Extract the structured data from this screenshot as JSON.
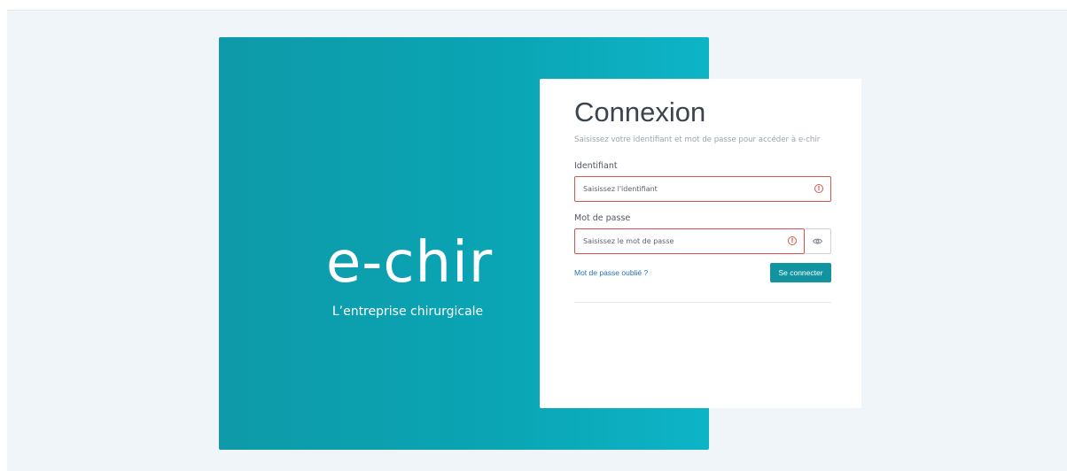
{
  "brand": {
    "logo_text": "e-chir",
    "tagline": "L’entreprise chirurgicale"
  },
  "login": {
    "title": "Connexion",
    "subtitle": "Saisissez votre identifiant et mot de passe pour accéder à e-chir",
    "identifier": {
      "label": "Identifiant",
      "placeholder": "Saisissez l'identifiant",
      "value": ""
    },
    "password": {
      "label": "Mot de passe",
      "placeholder": "Saisissez le mot de passe",
      "value": ""
    },
    "forgot_link": "Mot de passe oublié ?",
    "submit_label": "Se connecter",
    "error_icon": "error-circle-icon",
    "show_password_icon": "eye-icon"
  },
  "colors": {
    "brand_teal": "#0aa4b4",
    "button": "#1193a0",
    "error": "#d9534f",
    "link": "#1f6fb5",
    "background": "#eff5f8"
  }
}
